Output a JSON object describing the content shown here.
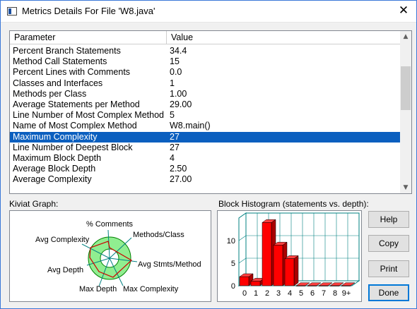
{
  "window": {
    "title": "Metrics Details For File 'W8.java'",
    "close_glyph": "✕"
  },
  "table": {
    "headers": [
      "Parameter",
      "Value"
    ],
    "rows": [
      {
        "parameter": "Percent Branch Statements",
        "value": "34.4"
      },
      {
        "parameter": "Method Call Statements",
        "value": "15"
      },
      {
        "parameter": "Percent Lines with Comments",
        "value": "0.0"
      },
      {
        "parameter": "Classes and Interfaces",
        "value": "1"
      },
      {
        "parameter": "Methods per Class",
        "value": "1.00"
      },
      {
        "parameter": "Average Statements per Method",
        "value": "29.00"
      },
      {
        "parameter": "Line Number of Most Complex Method",
        "value": "5"
      },
      {
        "parameter": "Name of Most Complex Method",
        "value": "W8.main()"
      },
      {
        "parameter": "Maximum Complexity",
        "value": "27"
      },
      {
        "parameter": "Line Number of Deepest Block",
        "value": "27"
      },
      {
        "parameter": "Maximum Block Depth",
        "value": "4"
      },
      {
        "parameter": "Average Block Depth",
        "value": "2.50"
      },
      {
        "parameter": "Average Complexity",
        "value": "27.00"
      }
    ],
    "selected_index": 8
  },
  "kiviat": {
    "label": "Kiviat Graph:",
    "axes": [
      "% Comments",
      "Methods/Class",
      "Avg Stmts/Method",
      "Max Complexity",
      "Max Depth",
      "Avg Depth",
      "Avg Complexity"
    ]
  },
  "histogram": {
    "label": "Block Histogram (statements vs. depth):"
  },
  "buttons": {
    "help": "Help",
    "copy": "Copy",
    "print": "Print",
    "done": "Done"
  },
  "chart_data": {
    "type": "bar",
    "categories": [
      "0",
      "1",
      "2",
      "3",
      "4",
      "5",
      "6",
      "7",
      "8",
      "9+"
    ],
    "values": [
      2,
      1,
      14,
      9,
      6,
      0,
      0,
      0,
      0,
      0
    ],
    "ylim": [
      0,
      15
    ],
    "yticks": [
      "0",
      "5",
      "10"
    ],
    "color": "#ff0000"
  },
  "colors": {
    "selection": "#0b5fbf",
    "bar": "#ff0000",
    "kiviat_ring": "#90ee90",
    "kiviat_line": "#cc0000"
  }
}
